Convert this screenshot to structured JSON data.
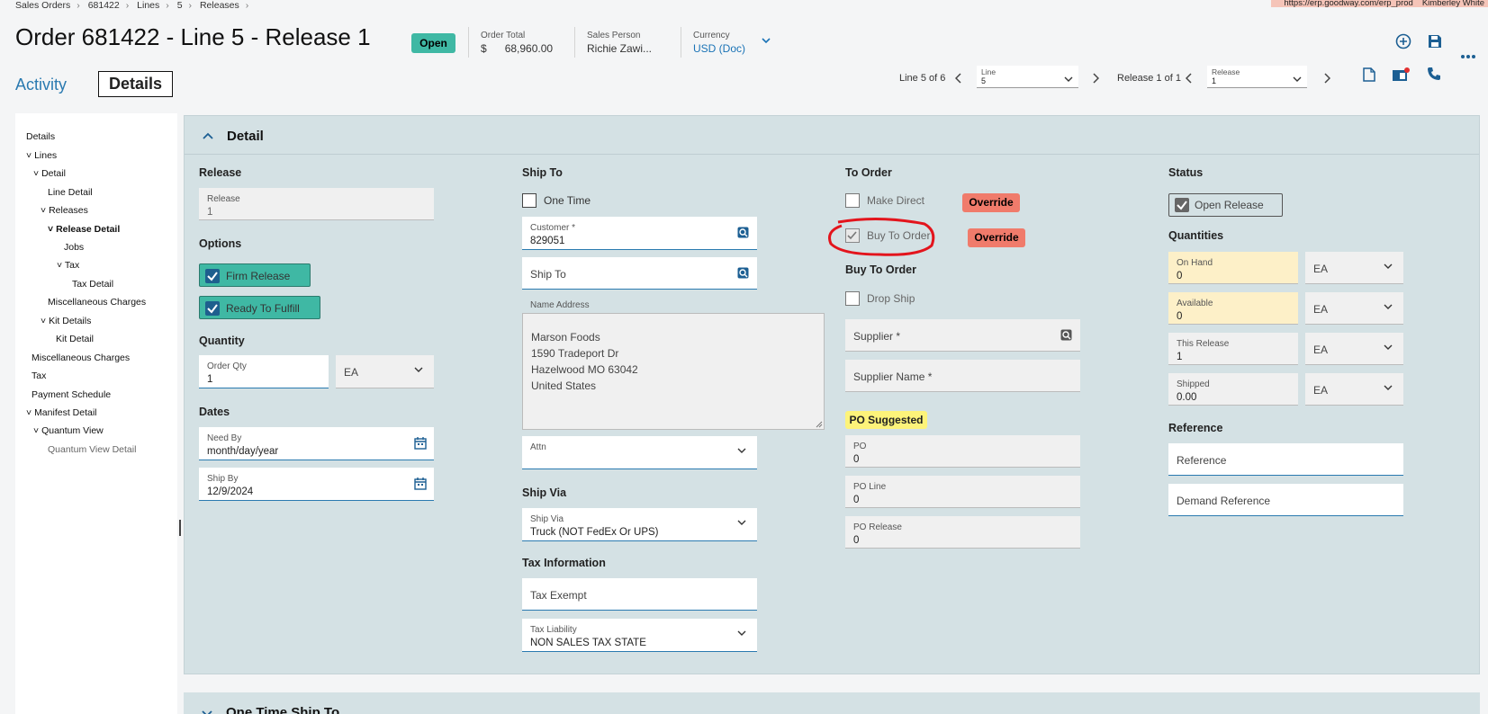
{
  "breadcrumb": [
    "Sales Orders",
    "681422",
    "Lines",
    "5",
    "Releases"
  ],
  "browser": {
    "url": "https://erp.goodway.com/erp_prod",
    "user": "Kimberley White"
  },
  "header": {
    "title": "Order 681422 - Line 5 - Release 1",
    "status": "Open",
    "order_total_label": "Order Total",
    "order_total_currency": "$",
    "order_total_value": "68,960.00",
    "sales_person_label": "Sales Person",
    "sales_person_value": "Richie Zawi...",
    "currency_label": "Currency",
    "currency_value": "USD (Doc)"
  },
  "tabs": {
    "activity": "Activity",
    "details": "Details"
  },
  "nav": {
    "line_count": "Line 5 of 6",
    "line_label": "Line",
    "line_value": "5",
    "release_count": "Release 1 of 1",
    "release_label": "Release",
    "release_value": "1"
  },
  "tree": [
    {
      "label": "Details"
    },
    {
      "label": "Lines"
    },
    {
      "label": "Detail"
    },
    {
      "label": "Line Detail"
    },
    {
      "label": "Releases"
    },
    {
      "label": "Release Detail"
    },
    {
      "label": "Jobs"
    },
    {
      "label": "Tax"
    },
    {
      "label": "Tax Detail"
    },
    {
      "label": "Miscellaneous Charges"
    },
    {
      "label": "Kit Details"
    },
    {
      "label": "Kit Detail"
    },
    {
      "label": "Miscellaneous Charges"
    },
    {
      "label": "Tax"
    },
    {
      "label": "Payment Schedule"
    },
    {
      "label": "Manifest Detail"
    },
    {
      "label": "Quantum View"
    },
    {
      "label": "Quantum View Detail"
    }
  ],
  "detail": {
    "section_title": "Detail",
    "release": {
      "heading": "Release",
      "label": "Release",
      "value": "1"
    },
    "options": {
      "heading": "Options",
      "firm_release": "Firm Release",
      "ready_to_fulfill": "Ready To Fulfill"
    },
    "quantity": {
      "heading": "Quantity",
      "order_qty_label": "Order Qty",
      "order_qty_value": "1",
      "uom": "EA"
    },
    "dates": {
      "heading": "Dates",
      "need_by_label": "Need By",
      "need_by_value": "month/day/year",
      "ship_by_label": "Ship By",
      "ship_by_value": "12/9/2024"
    },
    "ship_to": {
      "heading": "Ship To",
      "one_time": "One Time",
      "customer_label": "Customer *",
      "customer_value": "829051",
      "ship_to_placeholder": "Ship To",
      "name_address_label": "Name Address",
      "address_lines": [
        "Marson Foods",
        "1590 Tradeport Dr",
        "Hazelwood MO 63042",
        "United States"
      ],
      "attn_label": "Attn"
    },
    "ship_via": {
      "heading": "Ship Via",
      "label": "Ship Via",
      "value": "Truck (NOT FedEx Or UPS)"
    },
    "tax": {
      "heading": "Tax Information",
      "tax_exempt": "Tax Exempt",
      "liability_label": "Tax Liability",
      "liability_value": "NON SALES TAX STATE"
    },
    "to_order": {
      "heading": "To Order",
      "make_direct": "Make Direct",
      "buy_to_order": "Buy To Order",
      "override": "Override",
      "bto_heading": "Buy To Order",
      "drop_ship": "Drop Ship",
      "supplier": "Supplier *",
      "supplier_name": "Supplier Name *",
      "po_badge": "PO Suggested",
      "po_label": "PO",
      "po_value": "0",
      "po_line_label": "PO Line",
      "po_line_value": "0",
      "po_release_label": "PO Release",
      "po_release_value": "0"
    },
    "status": {
      "heading": "Status",
      "open_release": "Open Release",
      "quantities_heading": "Quantities",
      "on_hand_label": "On Hand",
      "on_hand_value": "0",
      "available_label": "Available",
      "available_value": "0",
      "this_release_label": "This Release",
      "this_release_value": "1",
      "shipped_label": "Shipped",
      "shipped_value": "0.00",
      "uom": "EA",
      "reference_heading": "Reference",
      "reference": "Reference",
      "demand_reference": "Demand Reference"
    }
  },
  "next_section": "One Time Ship To",
  "colors": {
    "accent": "#2a7ab0",
    "teal": "#3fb8a4",
    "override": "#f07b6b",
    "panel": "#d4e1e4",
    "annotation": "#e3141c"
  }
}
